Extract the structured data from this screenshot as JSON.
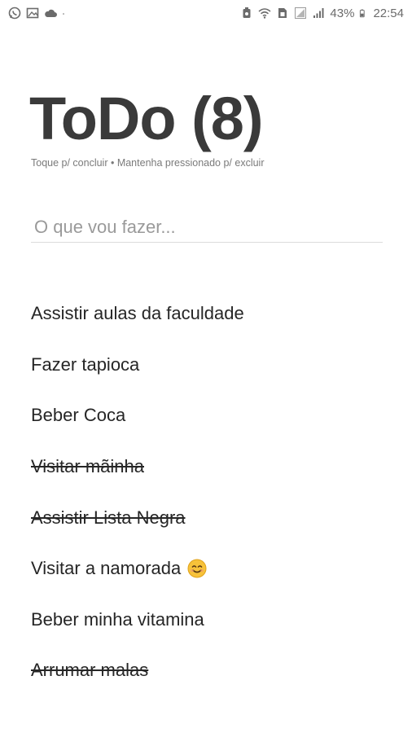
{
  "status_bar": {
    "battery_percent": "43%",
    "time": "22:54",
    "left_icons": [
      "whatsapp-icon",
      "gallery-icon",
      "cloud-icon",
      "dot-icon"
    ],
    "right_icons": [
      "alarm-icon",
      "wifi-icon",
      "sim-icon",
      "signal-icon",
      "signal-icon-2",
      "battery-icon"
    ]
  },
  "header": {
    "title": "ToDo (8)",
    "subtitle": "Toque p/ concluir • Mantenha pressionado p/ excluir"
  },
  "input": {
    "placeholder": "O que vou fazer...",
    "value": ""
  },
  "todos": [
    {
      "text": "Assistir aulas da faculdade",
      "done": false
    },
    {
      "text": "Fazer tapioca",
      "done": false
    },
    {
      "text": "Beber Coca",
      "done": false
    },
    {
      "text": "Visitar mãinha",
      "done": true
    },
    {
      "text": "Assistir Lista Negra",
      "done": true
    },
    {
      "text": "Visitar a namorada",
      "done": false,
      "emoji": "smiling-face-icon"
    },
    {
      "text": "Beber minha vitamina",
      "done": false
    },
    {
      "text": "Arrumar malas",
      "done": true
    }
  ],
  "colors": {
    "title": "#3a3a3a",
    "subtitle": "#7a7a7a",
    "text": "#262626",
    "divider": "#dcdcdc"
  }
}
